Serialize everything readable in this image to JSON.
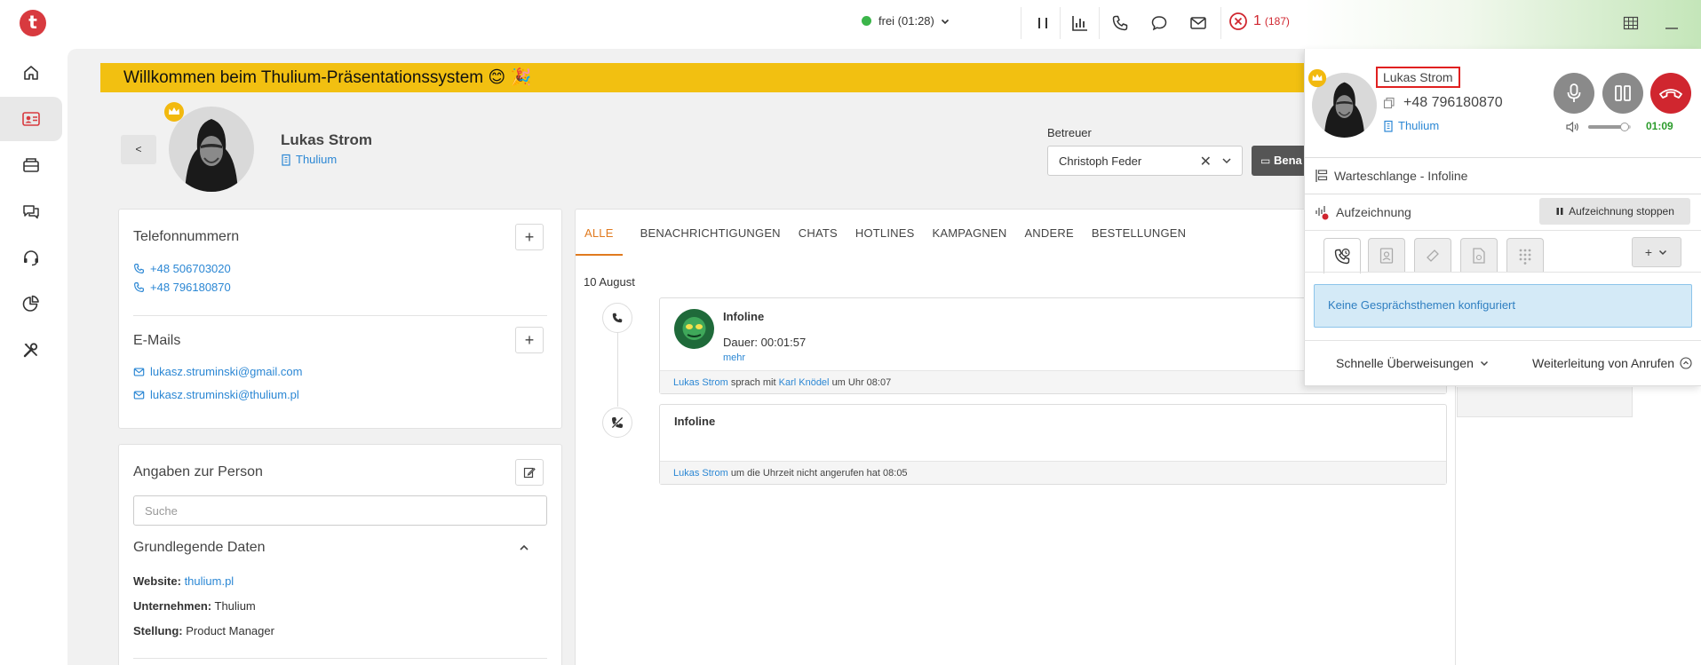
{
  "app": {
    "logo_letter": "t",
    "accent": "#d83a3f"
  },
  "topbar": {
    "status_label": "frei (01:28)",
    "status_color": "#3bb54a",
    "icons": [
      "pause-icon",
      "statistics-icon",
      "phone-icon",
      "chat-icon",
      "mail-icon",
      "error-icon"
    ],
    "alerts_count": "1",
    "alerts_sub": "(187)"
  },
  "sidebar": {
    "items": [
      "home-icon",
      "contacts-icon",
      "tickets-icon",
      "chats-icon",
      "headset-icon",
      "reports-icon",
      "tools-icon"
    ],
    "active_index": 1
  },
  "banner": {
    "text": "Willkommen beim Thulium-Präsentationssystem 😊 🎉",
    "color": "#f2c011"
  },
  "contact": {
    "back_label": "<",
    "name": "Lukas Strom",
    "company": "Thulium",
    "betreuer_label": "Betreuer",
    "betreuer_value": "Christoph Feder",
    "notify_button": "Bena"
  },
  "phones_card": {
    "title": "Telefonnummern",
    "numbers": [
      "+48 506703020",
      "+48 796180870"
    ],
    "emails_title": "E-Mails",
    "emails": [
      "lukasz.struminski@gmail.com",
      "lukasz.struminski@thulium.pl"
    ]
  },
  "person_card": {
    "title": "Angaben zur Person",
    "search_placeholder": "Suche",
    "section_title": "Grundlegende Daten",
    "website_label": "Website:",
    "website_value": "thulium.pl",
    "company_label": "Unternehmen:",
    "company_value": "Thulium",
    "position_label": "Stellung:",
    "position_value": "Product Manager"
  },
  "timeline": {
    "tabs": [
      "ALLE",
      "BENACHRICHTIGUNGEN",
      "CHATS",
      "HOTLINES",
      "KAMPAGNEN",
      "ANDERE",
      "BESTELLUNGEN"
    ],
    "active_tab": 0,
    "date": "10 August",
    "entries": [
      {
        "title": "Infoline",
        "duration": "Dauer: 00:01:57",
        "more": "mehr",
        "foot_name": "Lukas Strom",
        "foot_mid": "sprach mit",
        "foot_agent": "Karl Knödel",
        "foot_end": "um Uhr 08:07"
      },
      {
        "title": "Infoline",
        "foot_name": "Lukas Strom",
        "foot_end": "um die Uhrzeit nicht angerufen hat 08:05"
      }
    ]
  },
  "call_panel": {
    "caller_name": "Lukas Strom",
    "caller_phone": "+48 796180870",
    "caller_company": "Thulium",
    "timer": "01:09",
    "volume": 0.85,
    "queue": "Warteschlange - Infoline",
    "recording": "Aufzeichnung",
    "recording_stop": "Aufzeichnung stoppen",
    "tabs": [
      "call-history-icon",
      "contact-card-icon",
      "ticket-icon",
      "document-icon",
      "dialpad-icon"
    ],
    "plus_label": "+",
    "info": "Keine Gesprächsthemen konfiguriert",
    "quick_transfers": "Schnelle Überweisungen",
    "call_forwarding": "Weiterleitung von Anrufen",
    "colors": {
      "hangup": "#d0262f",
      "control": "#8a8a8a",
      "timer": "#2c9c2c"
    }
  }
}
